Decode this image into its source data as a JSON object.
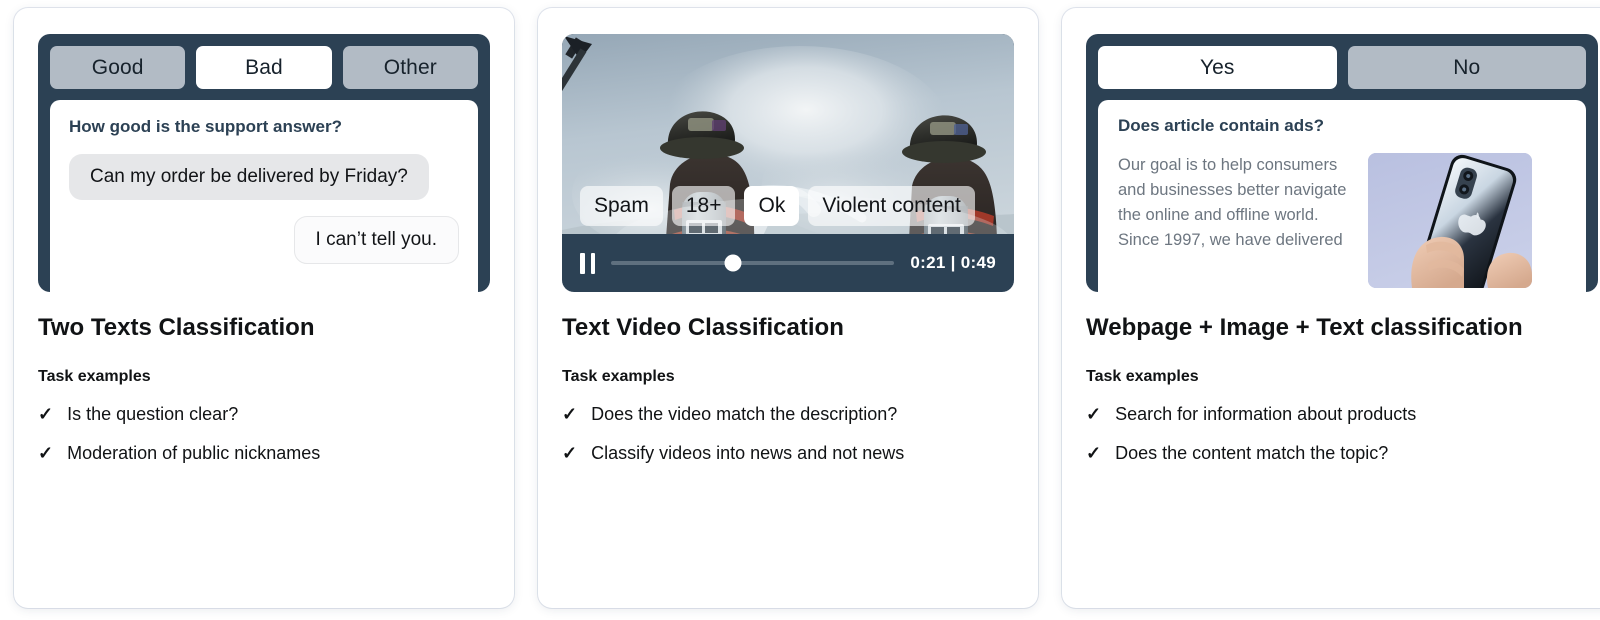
{
  "cards": [
    {
      "title": "Two Texts Classification",
      "examples_heading": "Task examples",
      "examples": [
        "Is the question clear?",
        "Moderation of public nicknames"
      ],
      "mock": {
        "type": "two-texts",
        "choices": [
          "Good",
          "Bad",
          "Other"
        ],
        "selected": "Bad",
        "question": "How good is the support answer?",
        "incoming_message": "Can my order be delivered by Friday?",
        "outgoing_message": "I can’t tell you."
      }
    },
    {
      "title": "Text Video Classification",
      "examples_heading": "Task examples",
      "examples": [
        "Does the video match the description?",
        "Classify videos into news and not news"
      ],
      "mock": {
        "type": "video",
        "labels": [
          "Spam",
          "18+",
          "Ok",
          "Violent content"
        ],
        "selected": "Ok",
        "play_state_icon": "pause-icon",
        "current_time": "0:21",
        "time_separator": "|",
        "total_time": "0:49",
        "progress_percent": 43,
        "scene_alt": "two firefighters spraying water into smoke"
      }
    },
    {
      "title": "Webpage + Image + Text classification",
      "examples_heading": "Task examples",
      "examples": [
        "Search for information about products",
        "Does the content match the topic?"
      ],
      "mock": {
        "type": "webpage",
        "choices": [
          "Yes",
          "No"
        ],
        "selected": "Yes",
        "question": "Does article contain ads?",
        "body": "Our goal is to help consumers and businesses better navigate the online and offline world. Since 1997, we have delivered",
        "photo_alt": "hands holding a smartphone"
      }
    }
  ],
  "colors": {
    "panel_dark": "#2c4154",
    "chip_grey": "#b2bbc5",
    "chip_selected": "#ffffff",
    "card_surface": "#ffffff",
    "text_primary": "#111315",
    "text_muted": "#6d7680",
    "bubble_incoming": "#e6e7e9"
  },
  "icons": {
    "check": "✓",
    "pause": "pause-icon"
  }
}
